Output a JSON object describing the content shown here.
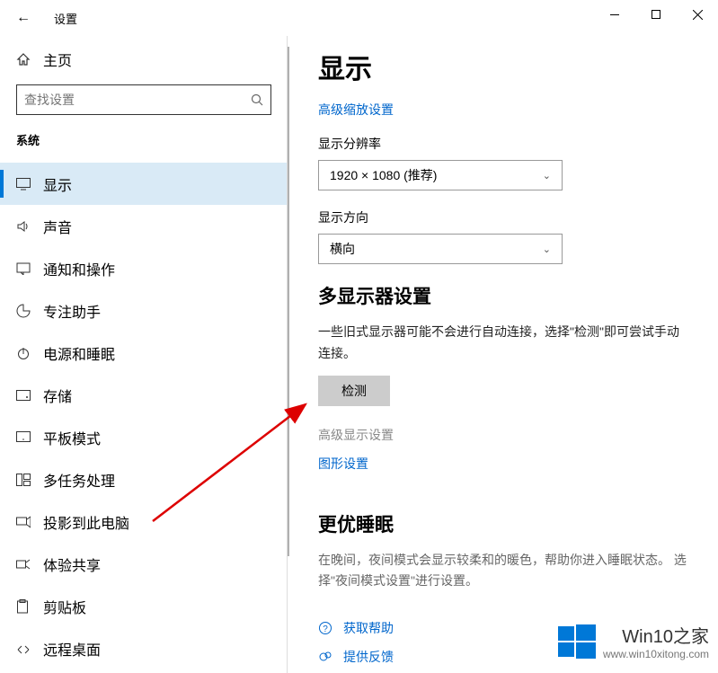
{
  "titlebar": {
    "title": "设置"
  },
  "sidebar": {
    "home": "主页",
    "search_placeholder": "查找设置",
    "category": "系统",
    "items": [
      {
        "label": "显示"
      },
      {
        "label": "声音"
      },
      {
        "label": "通知和操作"
      },
      {
        "label": "专注助手"
      },
      {
        "label": "电源和睡眠"
      },
      {
        "label": "存储"
      },
      {
        "label": "平板模式"
      },
      {
        "label": "多任务处理"
      },
      {
        "label": "投影到此电脑"
      },
      {
        "label": "体验共享"
      },
      {
        "label": "剪贴板"
      },
      {
        "label": "远程桌面"
      }
    ]
  },
  "main": {
    "heading": "显示",
    "adv_scale": "高级缩放设置",
    "res_label": "显示分辨率",
    "res_value": "1920 × 1080 (推荐)",
    "orient_label": "显示方向",
    "orient_value": "横向",
    "multi_heading": "多显示器设置",
    "multi_desc": "一些旧式显示器可能不会进行自动连接，选择\"检测\"即可尝试手动连接。",
    "detect_btn": "检测",
    "adv_display": "高级显示设置",
    "graphics": "图形设置",
    "sleep_heading": "更优睡眠",
    "sleep_desc": "在晚间，夜间模式会显示较柔和的暖色，帮助你进入睡眠状态。 选择\"夜间模式设置\"进行设置。",
    "help": "获取帮助",
    "feedback": "提供反馈"
  },
  "watermark": {
    "line1": "Win10之家",
    "line2": "www.win10xitong.com"
  }
}
